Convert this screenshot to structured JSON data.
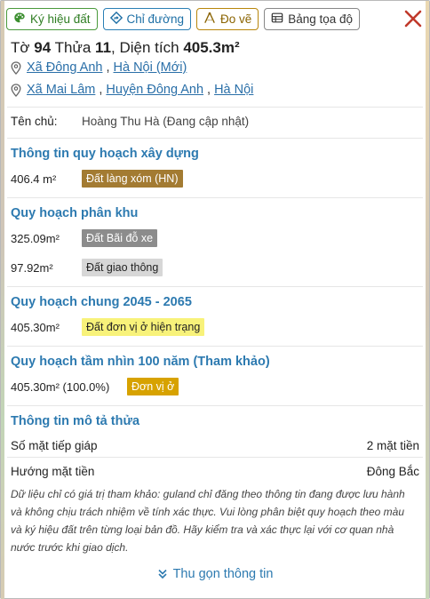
{
  "toolbar": {
    "symbol_label": "Ký hiệu đất",
    "directions_label": "Chỉ đường",
    "measure_label": "Đo vẽ",
    "coords_label": "Bảng tọa độ"
  },
  "parcel": {
    "sheet_label": "Tờ",
    "sheet_no": "94",
    "plot_label": "Thửa",
    "plot_no": "11",
    "area_label": ", Diện tích",
    "area_value": "405.3m²"
  },
  "location_new": {
    "commune": "Xã Đông Anh",
    "sep": ",",
    "city": "Hà Nội (Mới)"
  },
  "location_old": {
    "commune": "Xã Mai Lâm",
    "sep1": ",",
    "district": "Huyện Đông Anh",
    "sep2": ",",
    "city": "Hà Nội"
  },
  "owner": {
    "label": "Tên chủ:",
    "value": "Hoàng Thu Hà (Đang cập nhật)"
  },
  "sections": {
    "construction": {
      "title": "Thông tin quy hoạch xây dựng",
      "rows": [
        {
          "area": "406.4 m²",
          "tag": "Đất làng xóm (HN)"
        }
      ]
    },
    "zoning": {
      "title": "Quy hoạch phân khu",
      "rows": [
        {
          "area": "325.09m²",
          "tag": "Đất Bãi đỗ xe"
        },
        {
          "area": "97.92m²",
          "tag": "Đất giao thông"
        }
      ]
    },
    "general": {
      "title": "Quy hoạch chung 2045 - 2065",
      "rows": [
        {
          "area": "405.30m²",
          "tag": "Đất đơn vị ở hiện trạng"
        }
      ]
    },
    "vision": {
      "title": "Quy hoạch tầm nhìn 100 năm (Tham khảo)",
      "rows": [
        {
          "area": "405.30m² (100.0%)",
          "tag": "Đơn vị ở"
        }
      ]
    },
    "description": {
      "title": "Thông tin mô tả thửa",
      "frontage_label": "Số mặt tiếp giáp",
      "frontage_value": "2 mặt tiền",
      "direction_label": "Hướng mặt tiền",
      "direction_value": "Đông Bắc"
    }
  },
  "disclaimer": "Dữ liệu chỉ có giá trị tham khảo: guland chỉ đăng theo thông tin đang được lưu hành và không chịu trách nhiệm về tính xác thực. Vui lòng phân biệt quy hoạch theo màu và ký hiệu đất trên từng loại bản đồ. Hãy kiểm tra và xác thực lại với cơ quan nhà nước trước khi giao dịch.",
  "collapse_label": "Thu gọn thông tin",
  "colors": {
    "section_title": "#2d7ab0",
    "link": "#2a6fa8",
    "close": "#c0392b"
  }
}
